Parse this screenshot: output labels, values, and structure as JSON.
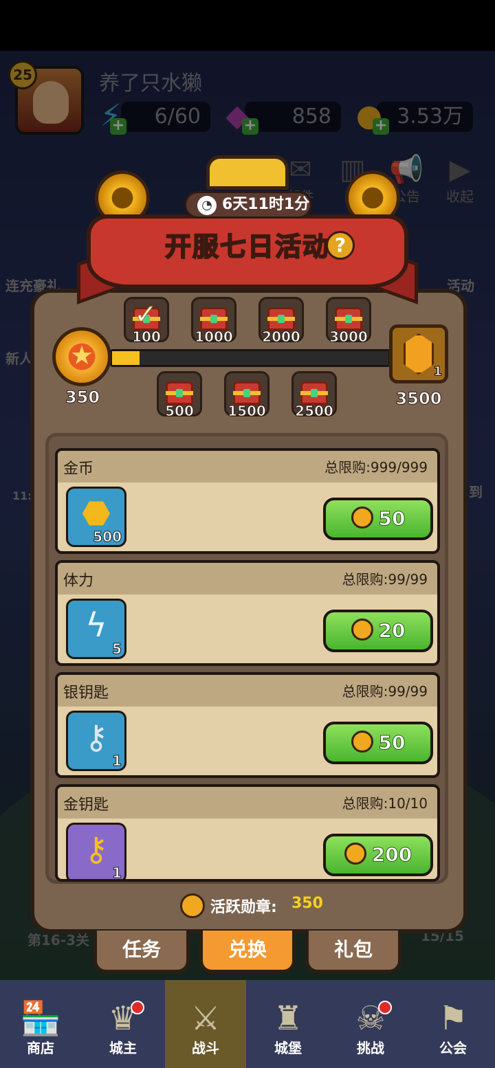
{
  "player": {
    "level": "25",
    "name": "养了只水獭"
  },
  "resources": {
    "stamina": "6/60",
    "gems": "858",
    "gold": "3.53万"
  },
  "hud_buttons": {
    "mail_partial": "邮件",
    "rank_partial": "排",
    "notice": "公告",
    "collapse": "收起"
  },
  "side_left": {
    "recharge": "连充豪礼",
    "newbie": "新人",
    "time_partial": "11:"
  },
  "side_right": {
    "activity": "活动",
    "checkin_partial": "到"
  },
  "event": {
    "title": "开服七日活动",
    "help": "?",
    "timer": "6天11时1分"
  },
  "progress": {
    "current": "350",
    "goal": "3500",
    "fraction": 0.1,
    "end_reward_count": "1",
    "top_chests": [
      {
        "label": "100",
        "claimed": true
      },
      {
        "label": "1000",
        "claimed": false
      },
      {
        "label": "2000",
        "claimed": false
      },
      {
        "label": "3000",
        "claimed": false
      }
    ],
    "bottom_chests": [
      {
        "label": "500"
      },
      {
        "label": "1500"
      },
      {
        "label": "2500"
      }
    ]
  },
  "shop": [
    {
      "name": "金币",
      "limit": "总限购:999/999",
      "qty": "500",
      "price": "50",
      "icon": "gold-coin-icon"
    },
    {
      "name": "体力",
      "limit": "总限购:99/99",
      "qty": "5",
      "price": "20",
      "icon": "lightning-icon"
    },
    {
      "name": "银钥匙",
      "limit": "总限购:99/99",
      "qty": "1",
      "price": "50",
      "icon": "silver-key-icon"
    },
    {
      "name": "金钥匙",
      "limit": "总限购:10/10",
      "qty": "1",
      "price": "200",
      "icon": "gold-key-icon"
    }
  ],
  "footer": {
    "label": "活跃勋章:",
    "value": "350"
  },
  "behind_text": {
    "stage": "第16-3关",
    "count": "15/15"
  },
  "subtabs": [
    "任务",
    "兑换",
    "礼包"
  ],
  "active_subtab": 1,
  "nav": [
    {
      "label": "商店",
      "icon": "shop-icon",
      "dot": false
    },
    {
      "label": "城主",
      "icon": "crown-icon",
      "dot": true
    },
    {
      "label": "战斗",
      "icon": "swords-icon",
      "dot": false
    },
    {
      "label": "城堡",
      "icon": "castle-icon",
      "dot": false
    },
    {
      "label": "挑战",
      "icon": "skull-icon",
      "dot": true
    },
    {
      "label": "公会",
      "icon": "banner-icon",
      "dot": false
    }
  ],
  "colors": {
    "accent_green": "#4ab530",
    "panel_brown": "#7a6450",
    "gold": "#f5c020",
    "active_tab": "#f59a30"
  }
}
